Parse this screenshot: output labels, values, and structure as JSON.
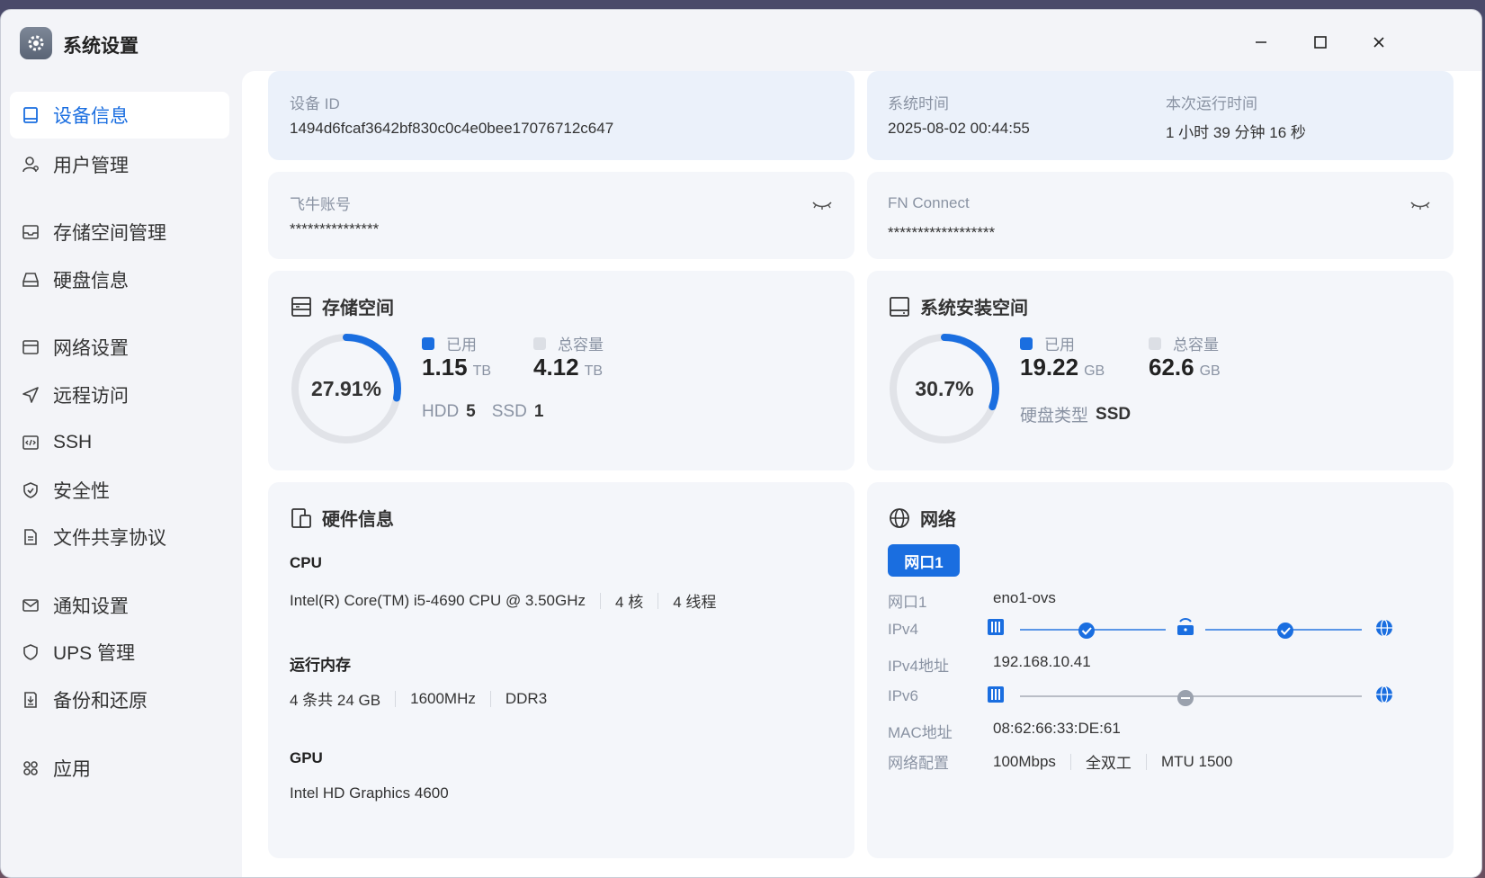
{
  "window": {
    "title": "系统设置"
  },
  "sidebar": {
    "items": [
      {
        "label": "设备信息",
        "icon": "device-icon"
      },
      {
        "label": "用户管理",
        "icon": "user-icon"
      },
      {
        "label": "存储空间管理",
        "icon": "storage-icon"
      },
      {
        "label": "硬盘信息",
        "icon": "disk-icon"
      },
      {
        "label": "网络设置",
        "icon": "network-icon"
      },
      {
        "label": "远程访问",
        "icon": "send-icon"
      },
      {
        "label": "SSH",
        "icon": "code-icon"
      },
      {
        "label": "安全性",
        "icon": "shield-check-icon"
      },
      {
        "label": "文件共享协议",
        "icon": "file-icon"
      },
      {
        "label": "通知设置",
        "icon": "mail-icon"
      },
      {
        "label": "UPS 管理",
        "icon": "shield-icon"
      },
      {
        "label": "备份和还原",
        "icon": "backup-icon"
      },
      {
        "label": "应用",
        "icon": "apps-icon"
      }
    ],
    "active": "设备信息"
  },
  "device": {
    "id_label": "设备 ID",
    "id_value": "1494d6fcaf3642bf830c0c4e0bee17076712c647",
    "time_label": "系统时间",
    "time_value": "2025-08-02 00:44:55",
    "uptime_label": "本次运行时间",
    "uptime_value": "1 小时 39 分钟 16 秒"
  },
  "accounts": {
    "fn_label": "飞牛账号",
    "fn_value": "***************",
    "connect_label": "FN Connect",
    "connect_value": "******************"
  },
  "storage": {
    "title": "存储空间",
    "percent_text": "27.91%",
    "percent": 27.91,
    "used_label": "已用",
    "used_value": "1.15",
    "used_unit": "TB",
    "total_label": "总容量",
    "total_value": "4.12",
    "total_unit": "TB",
    "hdd_label": "HDD",
    "hdd_count": "5",
    "ssd_label": "SSD",
    "ssd_count": "1"
  },
  "system_space": {
    "title": "系统安装空间",
    "percent_text": "30.7%",
    "percent": 30.7,
    "used_label": "已用",
    "used_value": "19.22",
    "used_unit": "GB",
    "total_label": "总容量",
    "total_value": "62.6",
    "total_unit": "GB",
    "disk_type_label": "硬盘类型",
    "disk_type_value": "SSD"
  },
  "hardware": {
    "title": "硬件信息",
    "cpu_label": "CPU",
    "cpu_model": "Intel(R) Core(TM) i5-4690 CPU @ 3.50GHz",
    "cpu_cores": "4 核",
    "cpu_threads": "4 线程",
    "ram_label": "运行内存",
    "ram_size": "4 条共 24 GB",
    "ram_freq": "1600MHz",
    "ram_type": "DDR3",
    "gpu_label": "GPU",
    "gpu_model": "Intel HD Graphics 4600"
  },
  "network": {
    "title": "网络",
    "tab": "网口1",
    "port_label": "网口1",
    "port_value": "eno1-ovs",
    "ipv4_label": "IPv4",
    "ipv4_addr_label": "IPv4地址",
    "ipv4_addr_value": "192.168.10.41",
    "ipv6_label": "IPv6",
    "mac_label": "MAC地址",
    "mac_value": "08:62:66:33:DE:61",
    "config_label": "网络配置",
    "speed": "100Mbps",
    "duplex": "全双工",
    "mtu": "MTU 1500"
  },
  "colors": {
    "accent": "#1a6ee0",
    "track": "#e1e3e8",
    "card": "#f4f6fa"
  }
}
